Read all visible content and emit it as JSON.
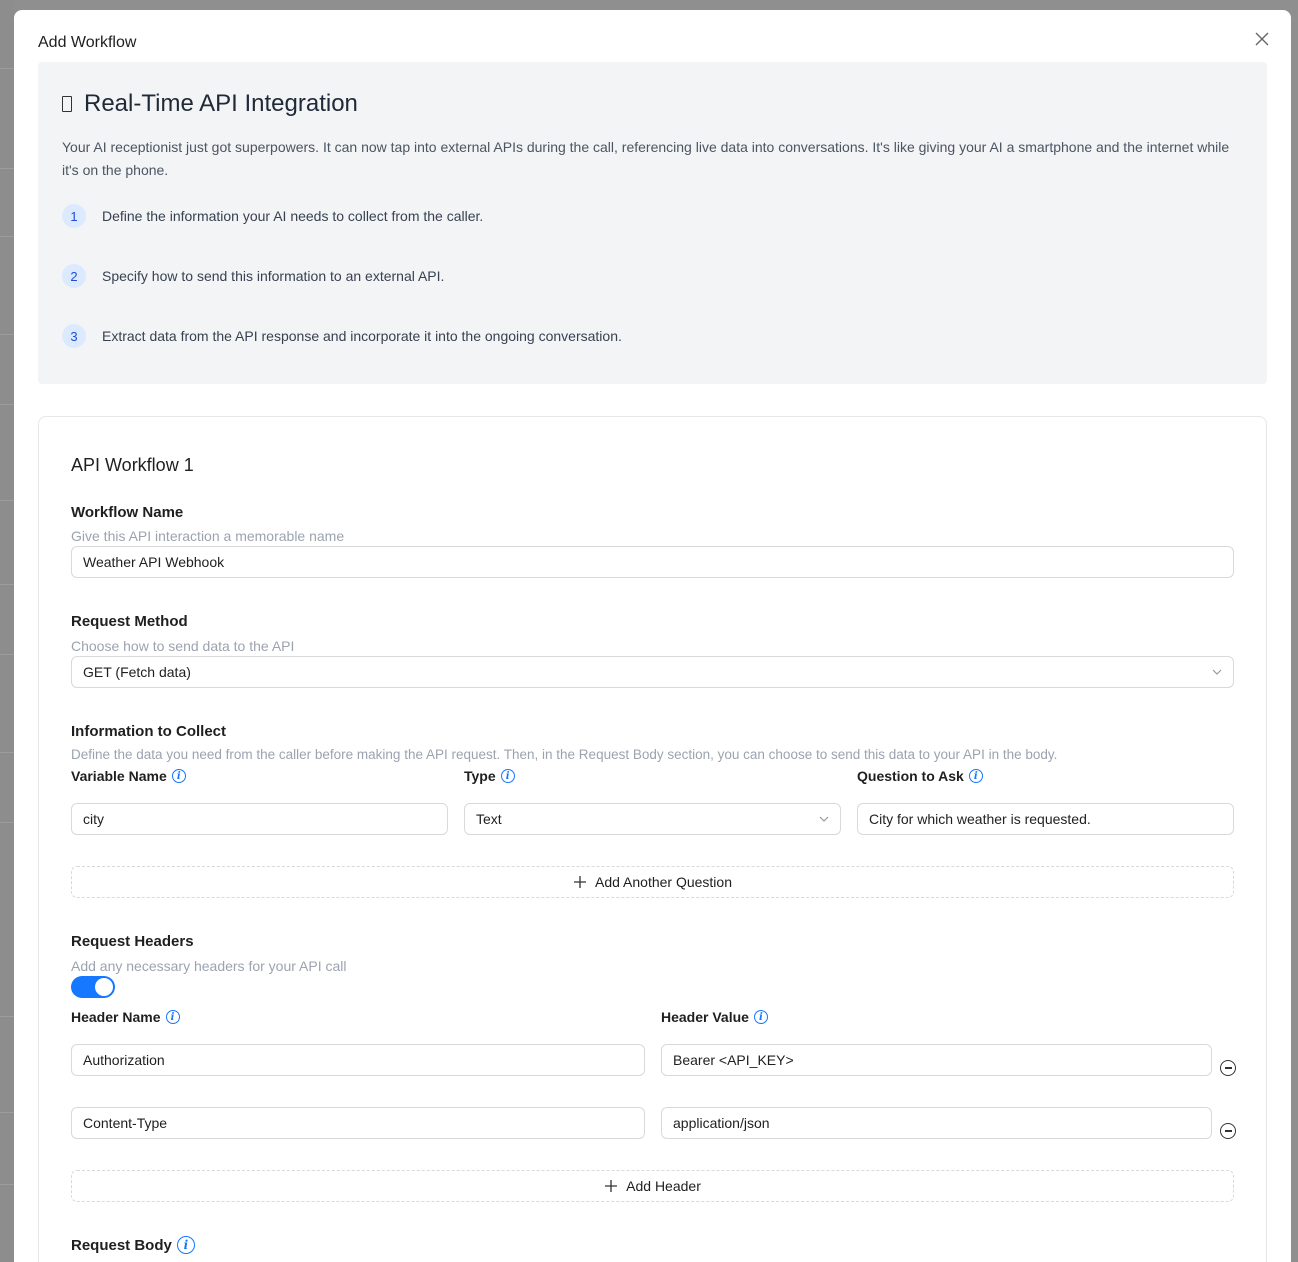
{
  "modal": {
    "title": "Add Workflow"
  },
  "intro": {
    "title": "Real-Time API Integration",
    "description": "Your AI receptionist just got superpowers. It can now tap into external APIs during the call, referencing live data into conversations. It's like giving your AI a smartphone and the internet while it's on the phone.",
    "steps": [
      {
        "num": "1",
        "text": "Define the information your AI needs to collect from the caller."
      },
      {
        "num": "2",
        "text": "Specify how to send this information to an external API."
      },
      {
        "num": "3",
        "text": "Extract data from the API response and incorporate it into the ongoing conversation."
      }
    ]
  },
  "workflow": {
    "title": "API Workflow 1",
    "name": {
      "label": "Workflow Name",
      "hint": "Give this API interaction a memorable name",
      "value": "Weather API Webhook"
    },
    "method": {
      "label": "Request Method",
      "hint": "Choose how to send data to the API",
      "value": "GET (Fetch data)"
    },
    "collect": {
      "label": "Information to Collect",
      "hint": "Define the data you need from the caller before making the API request. Then, in the Request Body section, you can choose to send this data to your API in the body.",
      "col_variable": "Variable Name",
      "col_type": "Type",
      "col_question": "Question to Ask",
      "rows": [
        {
          "variable": "city",
          "type": "Text",
          "question": "City for which weather is requested."
        }
      ],
      "add_label": "Add Another Question"
    },
    "headers": {
      "label": "Request Headers",
      "hint": "Add any necessary headers for your API call",
      "enabled": true,
      "col_name": "Header Name",
      "col_value": "Header Value",
      "rows": [
        {
          "name": "Authorization",
          "value": "Bearer <API_KEY>"
        },
        {
          "name": "Content-Type",
          "value": "application/json"
        }
      ],
      "add_label": "Add Header"
    },
    "body": {
      "label": "Request Body"
    }
  },
  "colors": {
    "accent": "#1677ff",
    "step_bg": "#dbeafe",
    "intro_bg": "#f3f4f6"
  },
  "icons": {
    "close": "close-icon",
    "info": "info-icon",
    "chevron": "chevron-down-icon",
    "plus": "plus-icon",
    "remove": "minus-circle-icon"
  }
}
